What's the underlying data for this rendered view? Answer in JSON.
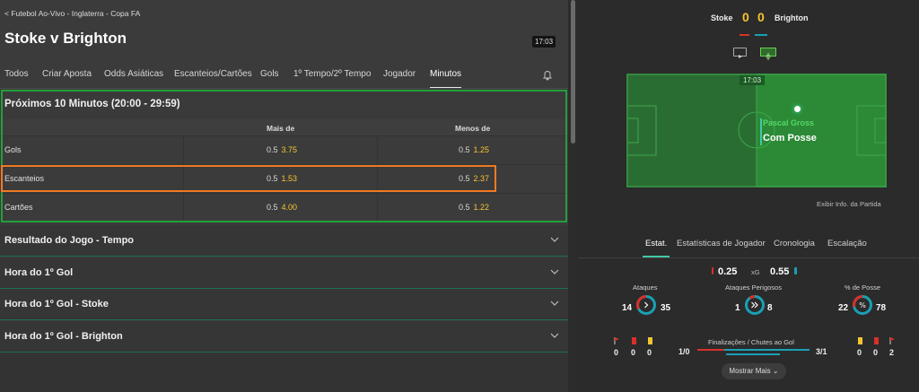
{
  "header": {
    "breadcrumb": "< Futebol Ao-Vivo - Inglaterra - Copa FA",
    "title": "Stoke v Brighton",
    "clock": "17:03"
  },
  "tabs": [
    "Todos",
    "Criar Aposta",
    "Odds Asiáticas",
    "Escanteios/Cartões",
    "Gols",
    "1º Tempo/2º Tempo",
    "Jogador",
    "Minutos"
  ],
  "active_tab": "Minutos",
  "open_section": {
    "title": "Próximos 10 Minutos (20:00 - 29:59)",
    "col_over": "Mais de",
    "col_under": "Menos de",
    "rows": [
      {
        "label": "Gols",
        "over_line": "0.5",
        "over_price": "3.75",
        "under_line": "0.5",
        "under_price": "1.25"
      },
      {
        "label": "Escanteios",
        "over_line": "0.5",
        "over_price": "1.53",
        "under_line": "0.5",
        "under_price": "2.37"
      },
      {
        "label": "Cartões",
        "over_line": "0.5",
        "over_price": "4.00",
        "under_line": "0.5",
        "under_price": "1.22"
      }
    ]
  },
  "collapsed_sections": [
    "Resultado do Jogo - Tempo",
    "Hora do 1º Gol",
    "Hora do 1º Gol - Stoke",
    "Hora do 1º Gol - Brighton"
  ],
  "match": {
    "home": "Stoke",
    "away": "Brighton",
    "home_score": "0",
    "away_score": "0",
    "pitch_clock": "17:03",
    "player": "Pascal Gross",
    "status": "Com Posse",
    "info_link": "Exibir Info. da Partida"
  },
  "stats_tabs": [
    "Estat.",
    "Estatísticas de Jogador",
    "Cronologia",
    "Escalação"
  ],
  "stats": {
    "xg_home": "0.25",
    "xg_label": "xG",
    "xg_away": "0.55",
    "ataques": {
      "label": "Ataques",
      "home": "14",
      "away": "35"
    },
    "perigosos": {
      "label": "Ataques Perigosos",
      "home": "1",
      "away": "8"
    },
    "posse": {
      "label": "% de Posse",
      "home": "22",
      "away": "78"
    },
    "finalizacoes": {
      "label": "Finalizações / Chutes ao Gol",
      "home": "1/0",
      "away": "3/1"
    },
    "home_cards": [
      "0",
      "0",
      "0"
    ],
    "away_cards": [
      "0",
      "0",
      "2"
    ],
    "more": "Mostrar Mais"
  },
  "colors": {
    "price": "#f4c531",
    "home": "#d9302a",
    "away": "#1aa0b5",
    "highlight_green": "#22a03a",
    "highlight_orange": "#f07a22"
  }
}
